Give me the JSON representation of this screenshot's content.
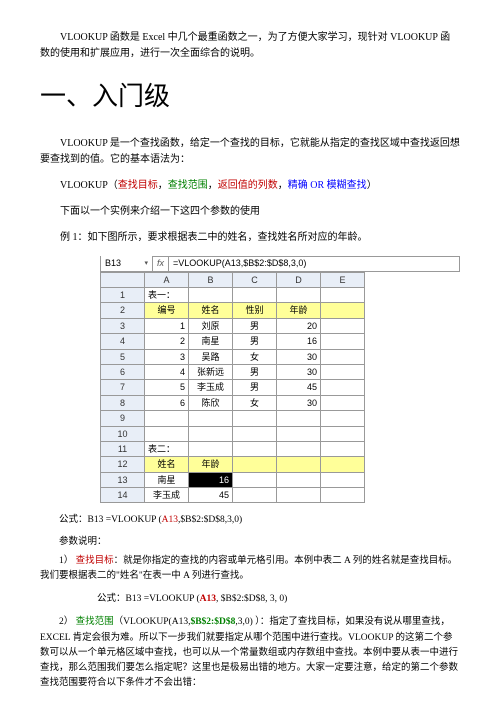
{
  "intro": "VLOOKUP 函数是 Excel 中几个最重函数之一，为了方便大家学习，现针对 VLOOKUP 函数的使用和扩展应用，进行一次全面综合的说明。",
  "h1": "一、入门级",
  "p1": "VLOOKUP 是一个查找函数，给定一个查找的目标，它就能从指定的查找区域中查找返回想要查找到的值。它的基本语法为：",
  "syntax_prefix": "VLOOKUP（",
  "syntax_arg1": "查找目标",
  "syntax_sep1": "，",
  "syntax_arg2": "查找范围",
  "syntax_sep2": "，",
  "syntax_arg3": "返回值的列数",
  "syntax_sep3": "，",
  "syntax_arg4": "精确 OR 模糊查找",
  "syntax_suffix": "）",
  "p2": "下面以一个实例来介绍一下这四个参数的使用",
  "p3": "例 1：如下图所示，要求根据表二中的姓名，查找姓名所对应的年龄。",
  "excel": {
    "namebox": "B13",
    "formula": "=VLOOKUP(A13,$B$2:$D$8,3,0)",
    "cols": [
      "A",
      "B",
      "C",
      "D",
      "E"
    ],
    "rows": [
      {
        "n": "1",
        "cells": [
          "表一：",
          "",
          "",
          "",
          ""
        ]
      },
      {
        "n": "2",
        "cells": [
          "编号",
          "姓名",
          "性别",
          "年龄",
          ""
        ]
      },
      {
        "n": "3",
        "cells": [
          "1",
          "刘原",
          "男",
          "20",
          ""
        ]
      },
      {
        "n": "4",
        "cells": [
          "2",
          "南星",
          "男",
          "16",
          ""
        ]
      },
      {
        "n": "5",
        "cells": [
          "3",
          "吴路",
          "女",
          "30",
          ""
        ]
      },
      {
        "n": "6",
        "cells": [
          "4",
          "张新远",
          "男",
          "30",
          ""
        ]
      },
      {
        "n": "7",
        "cells": [
          "5",
          "李玉成",
          "男",
          "45",
          ""
        ]
      },
      {
        "n": "8",
        "cells": [
          "6",
          "陈欣",
          "女",
          "30",
          ""
        ]
      },
      {
        "n": "9",
        "cells": [
          "",
          "",
          "",
          "",
          ""
        ]
      },
      {
        "n": "10",
        "cells": [
          "",
          "",
          "",
          "",
          ""
        ]
      },
      {
        "n": "11",
        "cells": [
          "表二：",
          "",
          "",
          "",
          ""
        ]
      },
      {
        "n": "12",
        "cells": [
          "姓名",
          "年龄",
          "",
          "",
          ""
        ]
      },
      {
        "n": "13",
        "cells": [
          "南星",
          "16",
          "",
          "",
          ""
        ]
      },
      {
        "n": "14",
        "cells": [
          "李玉成",
          "45",
          "",
          "",
          ""
        ]
      }
    ]
  },
  "formula_line_prefix": "公式：B13 =VLOOKUP (",
  "formula_line_a13": "A13",
  "formula_line_suffix": ",$B$2:$D$8,3,0)",
  "param_label": "参数说明：",
  "param1_num": "1）",
  "param1_title": "查找目标",
  "param1_body": "：就是你指定的查找的内容或单元格引用。本例中表二 A 列的姓名就是查找目标。我们要根据表二的\"姓名\"在表一中 A 列进行查找。",
  "param1_formula_prefix": "公式：B13  =VLOOKUP (",
  "param1_formula_a13": "A13",
  "param1_formula_suffix": ", $B$2:$D$8, 3, 0)",
  "param2_num": "2）",
  "param2_title": "查找范围",
  "param2_paren_prefix": "（VLOOKUP(A13,",
  "param2_paren_green": "$B$2:$D$8",
  "param2_paren_suffix": ",3,0)  ）",
  "param2_body": "：指定了查找目标，如果没有说从哪里查找，EXCEL 肯定会很为难。所以下一步我们就要指定从哪个范围中进行查找。VLOOKUP 的这第二个参数可以从一个单元格区域中查找，也可以从一个常量数组或内存数组中查找。本例中要从表一中进行查找，那么范围我们要怎么指定呢？这里也是极易出错的地方。大家一定要注意，给定的第二个参数查找范围要符合以下条件才不会出错："
}
